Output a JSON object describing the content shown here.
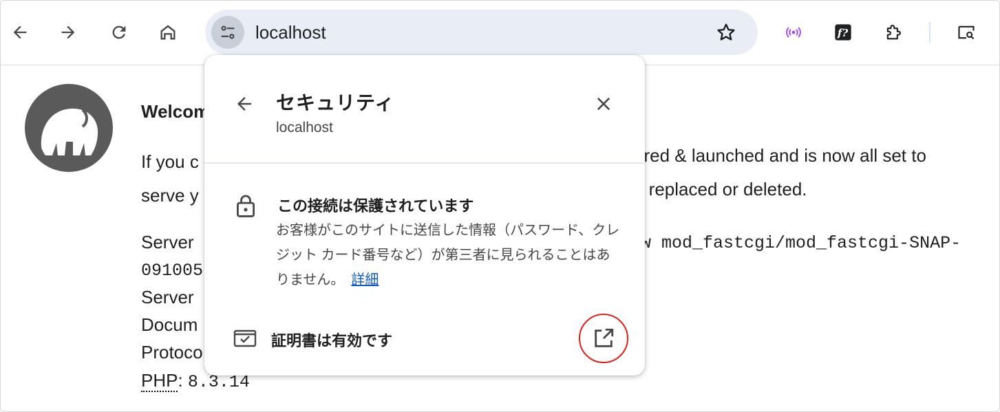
{
  "browser": {
    "url": "localhost",
    "icons": [
      "back-icon",
      "forward-icon",
      "reload-icon",
      "home-icon",
      "site-info-icon",
      "star-icon",
      "cast-icon",
      "font-ext-icon",
      "extensions-icon",
      "tab-search-icon"
    ]
  },
  "page": {
    "welcome": "Welcom",
    "para_left_1": "If you c",
    "para_right_1": "ured & launched and is now all set to",
    "para_left_2": "serve y",
    "para_right_2": "e replaced or deleted.",
    "server_label": "Server ",
    "server_value_right": "w mod_fastcgi/mod_fastcgi-SNAP-",
    "server_value_cont": "091005",
    "server2": "Server ",
    "doc": "Docum",
    "protocol": "Protoco",
    "php_label": "PHP",
    "php_sep": ": ",
    "php_value": "8.3.14"
  },
  "popup": {
    "title": "セキュリティ",
    "subtitle": "localhost",
    "connection_title": "この接続は保護されています",
    "connection_desc": "お客様がこのサイトに送信した情報（パスワード、クレジット カード番号など）が第三者に見られることはありません。",
    "connection_link": "詳細",
    "certificate_label": "証明書は有効です",
    "colors": {
      "link": "#0b57d0",
      "highlight_circle": "#e0201a"
    }
  }
}
